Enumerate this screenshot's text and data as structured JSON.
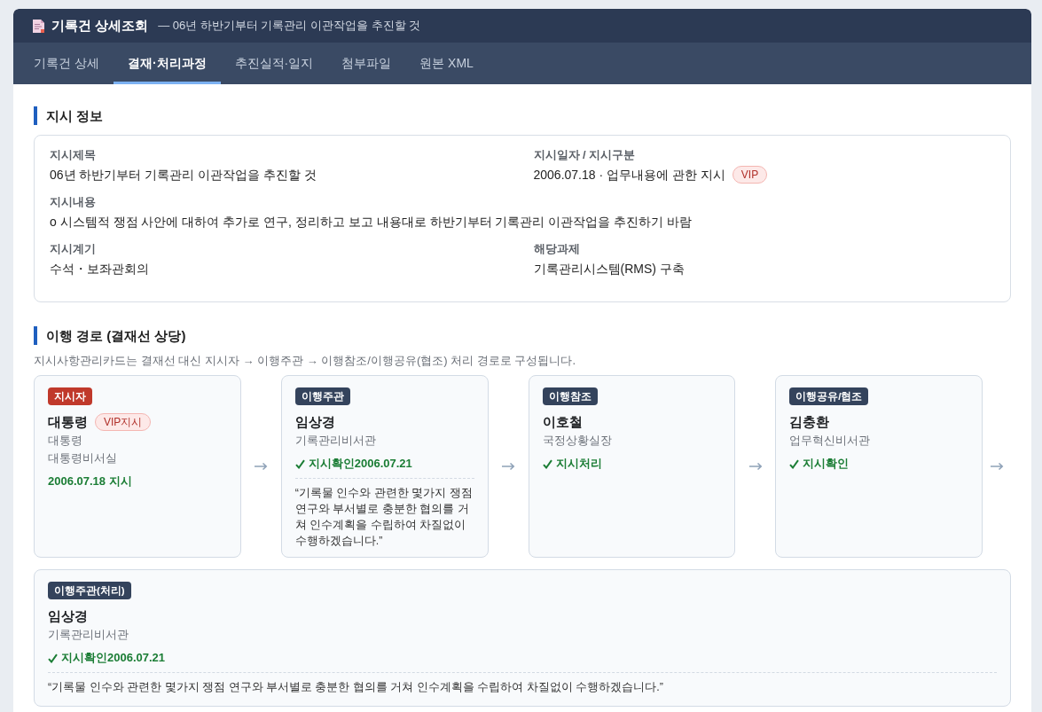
{
  "header": {
    "title": "기록건 상세조회",
    "subtitle": "— 06년 하반기부터 기록관리 이관작업을 추진할 것"
  },
  "tabs": [
    {
      "label": "기록건 상세",
      "selected": false
    },
    {
      "label": "결재·처리과정",
      "selected": true
    },
    {
      "label": "추진실적·일지",
      "selected": false
    },
    {
      "label": "첨부파일",
      "selected": false
    },
    {
      "label": "원본 XML",
      "selected": false
    }
  ],
  "info": {
    "title": "지시 정보",
    "rows": [
      [
        {
          "label": "지시제목",
          "value": "06년 하반기부터 기록관리 이관작업을 추진할 것"
        },
        {
          "label": "지시일자 / 지시구분",
          "value": "2006.07.18 · 업무내용에 관한 지시",
          "tag": "VIP"
        }
      ],
      [
        {
          "label": "지시내용",
          "value": "o 시스템적 쟁점 사안에 대하여 추가로 연구, 정리하고 보고 내용대로 하반기부터 기록관리 이관작업을 추진하기 바람"
        }
      ],
      [
        {
          "label": "지시계기",
          "value": "수석・보좌관회의"
        },
        {
          "label": "해당과제",
          "value": "기록관리시스템(RMS) 구축"
        }
      ]
    ]
  },
  "route": {
    "title": "이행 경로 (결재선 상당)",
    "description": "지시사항관리카드는 결재선 대신 지시자 → 이행주관 → 이행참조/이행공유(협조) 처리 경로로 구성됩니다.",
    "nodes": [
      {
        "role": "지시자",
        "color": "#c0392b",
        "name": "대통령",
        "tag": "VIP지시",
        "details": [
          "대통령",
          "대통령비서실"
        ],
        "status": "2006.07.18 지시",
        "done": false
      },
      {
        "role": "이행주관",
        "color": "#34435c",
        "name": "임상경",
        "details": [
          "기록관리비서관"
        ],
        "status": "지시확인2006.07.21",
        "done": true,
        "comment": "“기록물 인수와 관련한 몇가지 쟁점 연구와 부서별로 충분한 협의를 거쳐 인수계획을 수립하여 차질없이 수행하겠습니다.”"
      },
      {
        "role": "이행참조",
        "color": "#34435c",
        "name": "이호철",
        "details": [
          "국정상황실장"
        ],
        "status": "지시처리",
        "done": true
      },
      {
        "role": "이행공유/협조",
        "color": "#34435c",
        "name": "김충환",
        "details": [
          "업무혁신비서관"
        ],
        "status": "지시확인",
        "done": true
      },
      {
        "role": "이행주관(처리)",
        "color": "#34435c",
        "name": "임상경",
        "details": [
          "기록관리비서관"
        ],
        "status": "지시확인2006.07.21",
        "done": true,
        "comment": "“기록물 인수와 관련한 몇가지 쟁점 연구와 부서별로 충분한 협의를 거쳐 인수계획을 수립하여 차질없이 수행하겠습니다.”"
      }
    ]
  }
}
